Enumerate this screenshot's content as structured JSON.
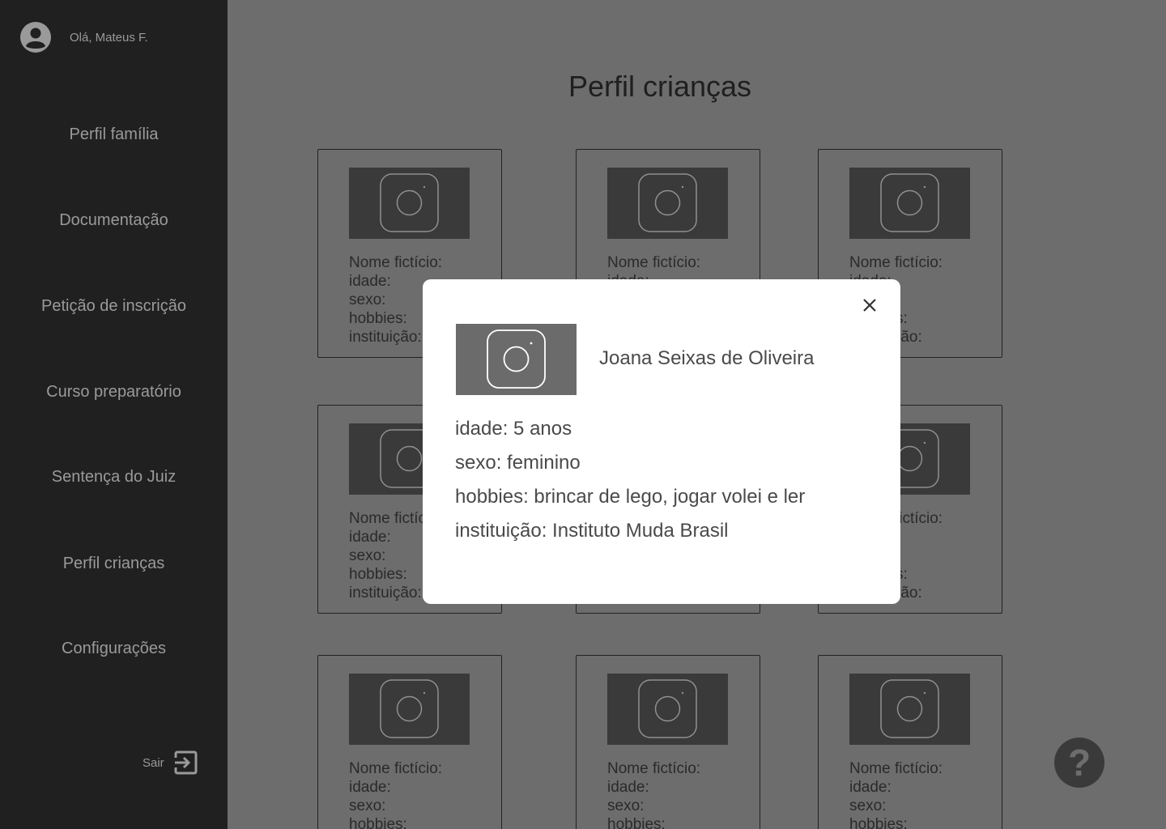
{
  "sidebar": {
    "greeting": "Olá, Mateus F.",
    "items": [
      {
        "label": "Perfil família"
      },
      {
        "label": "Documentação"
      },
      {
        "label": "Petição de inscrição"
      },
      {
        "label": "Curso preparatório"
      },
      {
        "label": "Sentença do Juiz"
      },
      {
        "label": "Perfil crianças"
      },
      {
        "label": "Configurações"
      }
    ],
    "logout_label": "Sair"
  },
  "main": {
    "title": "Perfil crianças",
    "card_labels": {
      "name": "Nome fictício:",
      "age": "idade:",
      "sex": "sexo:",
      "hobbies": "hobbies:",
      "institution": "instituição:"
    },
    "help_label": "?"
  },
  "modal": {
    "name": "Joana Seixas de Oliveira",
    "age": "idade: 5 anos",
    "sex": "sexo: feminino",
    "hobbies": "hobbies: brincar de lego, jogar volei e ler",
    "institution": "instituição: Instituto Muda Brasil"
  }
}
